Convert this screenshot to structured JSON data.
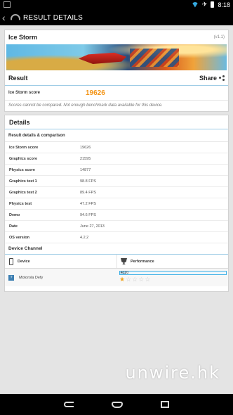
{
  "status_bar": {
    "time": "8:18"
  },
  "action_bar": {
    "title": "RESULT DETAILS"
  },
  "card_result": {
    "title": "Ice Storm",
    "version": "(v1.1)",
    "result_label": "Result",
    "share_label": "Share",
    "score_label": "Ice Storm score",
    "score_value": "19626",
    "note": "Scores cannot be compared. Not enough benchmark data available for this device."
  },
  "card_details": {
    "title": "Details",
    "subtitle": "Result details & comparison",
    "rows": [
      {
        "label": "Ice Storm score",
        "value": "19626"
      },
      {
        "label": "Graphics score",
        "value": "21595"
      },
      {
        "label": "Physics score",
        "value": "14877"
      },
      {
        "label": "Graphics test 1",
        "value": "98.8 FPS"
      },
      {
        "label": "Graphics test 2",
        "value": "89.4 FPS"
      },
      {
        "label": "Physics test",
        "value": "47.2 FPS"
      },
      {
        "label": "Demo",
        "value": "94.6 FPS"
      },
      {
        "label": "Date",
        "value": "June 27, 2013"
      },
      {
        "label": "OS version",
        "value": "4.2.2"
      }
    ],
    "device_channel": {
      "title": "Device Channel",
      "col_device": "Device",
      "col_performance": "Performance",
      "row": {
        "badge": "?",
        "device": "Motorola Defy",
        "perf_text": "4120",
        "perf_fraction": 0.05,
        "stars_filled": 1,
        "stars_total": 5
      }
    }
  },
  "watermark": "unwire.hk",
  "colors": {
    "accent_orange": "#f39416",
    "accent_blue": "#3db0e6"
  }
}
